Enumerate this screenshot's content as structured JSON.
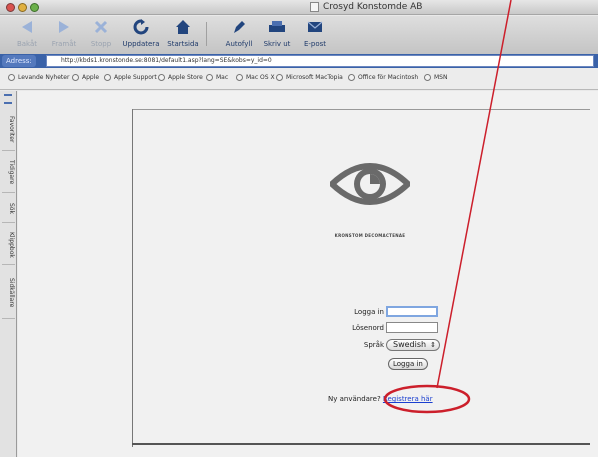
{
  "window": {
    "title": "Crosyd Konstomde AB"
  },
  "toolbar": {
    "buttons": [
      {
        "label": "Bakåt",
        "icon": "back-arrow-icon",
        "enabled": false
      },
      {
        "label": "Framåt",
        "icon": "forward-arrow-icon",
        "enabled": false
      },
      {
        "label": "Stopp",
        "icon": "stop-x-icon",
        "enabled": false
      },
      {
        "label": "Uppdatera",
        "icon": "refresh-icon",
        "enabled": true
      },
      {
        "label": "Startsida",
        "icon": "home-icon",
        "enabled": true
      },
      {
        "label": "Autofyll",
        "icon": "autofill-pen-icon",
        "enabled": true
      },
      {
        "label": "Skriv ut",
        "icon": "printer-icon",
        "enabled": true
      },
      {
        "label": "E-post",
        "icon": "mail-icon",
        "enabled": true
      }
    ]
  },
  "address": {
    "label": "Adress:",
    "url": "http://kbds1.kronstonde.se:8081/default1.asp?lang=SE&kobs=y_id=0"
  },
  "favorites": [
    "Levande Nyheter",
    "Apple",
    "Apple Support",
    "Apple Store",
    "Mac",
    "Mac OS X",
    "Microsoft MacTopia",
    "Office för Macintosh",
    "MSN"
  ],
  "sidebar": {
    "tabs": [
      "Favoriter",
      "Tidigare",
      "Sök",
      "Klippbok",
      "Sidkällare"
    ]
  },
  "page": {
    "brand_text": "KRONSTOM DECOMACTENAE",
    "login_label": "Logga in",
    "password_label": "Lösenord",
    "language_label": "Språk",
    "language_value": "Swedish",
    "login_button": "Logga in",
    "new_user_text": "Ny användare?",
    "register_link": "Registrera här"
  },
  "annotation": {
    "color": "#cc1f2b"
  }
}
